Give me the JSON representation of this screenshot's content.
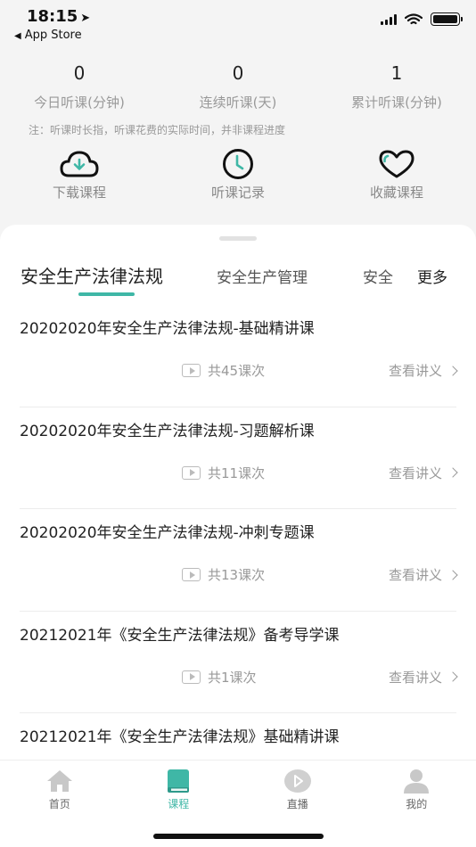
{
  "status_bar": {
    "time": "18:15",
    "location_arrow": "➤",
    "back_label": "App Store"
  },
  "stats": [
    {
      "value": "0",
      "label": "今日听课(分钟)"
    },
    {
      "value": "0",
      "label": "连续听课(天)"
    },
    {
      "value": "1",
      "label": "累计听课(分钟)"
    }
  ],
  "note": "注：听课时长指，听课花费的实际时间，并非课程进度",
  "shortcuts": [
    {
      "label": "下载课程",
      "icon": "cloud-download-icon"
    },
    {
      "label": "听课记录",
      "icon": "clock-icon"
    },
    {
      "label": "收藏课程",
      "icon": "heart-icon"
    }
  ],
  "tabs": {
    "active": "安全生产法律法规",
    "second": "安全生产管理",
    "third": "安全",
    "more": "更多"
  },
  "courses": [
    {
      "title": "20202020年安全生产法律法规-基础精讲课",
      "count": "共45课次",
      "notes": "查看讲义"
    },
    {
      "title": "20202020年安全生产法律法规-习题解析课",
      "count": "共11课次",
      "notes": "查看讲义"
    },
    {
      "title": "20202020年安全生产法律法规-冲刺专题课",
      "count": "共13课次",
      "notes": "查看讲义"
    },
    {
      "title": "20212021年《安全生产法律法规》备考导学课",
      "count": "共1课次",
      "notes": "查看讲义"
    },
    {
      "title": "20212021年《安全生产法律法规》基础精讲课",
      "count": "",
      "notes": ""
    }
  ],
  "nav": [
    {
      "label": "首页",
      "icon": "home-icon"
    },
    {
      "label": "课程",
      "icon": "book-icon"
    },
    {
      "label": "直播",
      "icon": "play-icon"
    },
    {
      "label": "我的",
      "icon": "user-icon"
    }
  ],
  "colors": {
    "accent": "#3fb7a6",
    "background": "#f4f4f4"
  }
}
